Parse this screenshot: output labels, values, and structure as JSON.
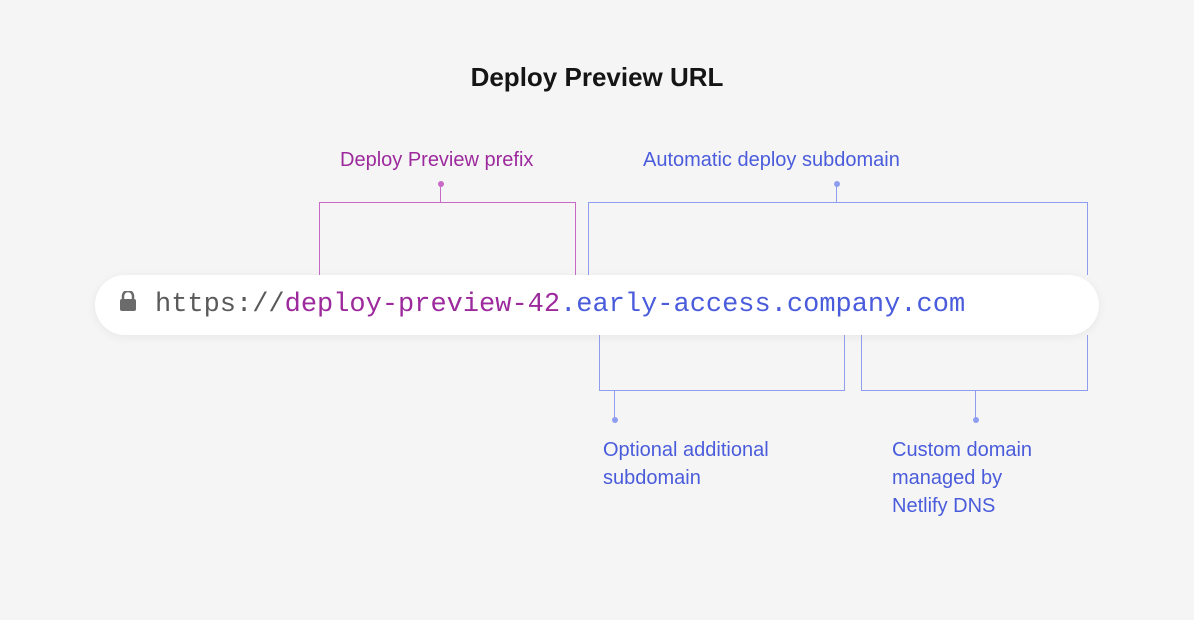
{
  "title": "Deploy Preview URL",
  "url": {
    "protocol": "https://",
    "prefix": "deploy-preview-42",
    "dot1": ".",
    "subdomain": "early-access",
    "dot2": ".",
    "domain": "company.com"
  },
  "labels": {
    "prefix": "Deploy Preview prefix",
    "auto": "Automatic deploy subdomain",
    "optional_line1": "Optional additional",
    "optional_line2": "subdomain",
    "custom_line1": "Custom domain",
    "custom_line2": "managed by",
    "custom_line3": "Netlify DNS"
  },
  "colors": {
    "magenta": "#9d2a9d",
    "blue": "#4a5cdb",
    "gray": "#5a5a5a"
  }
}
